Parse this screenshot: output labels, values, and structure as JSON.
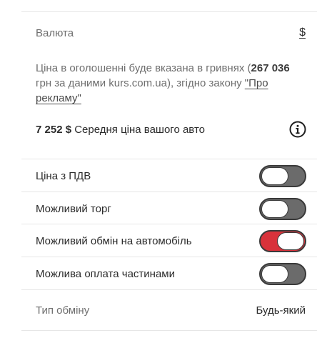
{
  "currency": {
    "label": "Валюта",
    "value": "$"
  },
  "price_note": {
    "text_before": "Ціна в оголошенні буде вказана в гривнях (",
    "amount": "267 036",
    "text_after": " грн за даними kurs.com.ua), згідно закону ",
    "law_link": "\"Про рекламу\""
  },
  "average_price": {
    "amount": "7 252 $",
    "text": " Середня ціна вашого авто",
    "info_icon": "info-circle-icon"
  },
  "options": [
    {
      "label": "Ціна з ПДВ",
      "enabled": false
    },
    {
      "label": "Можливий торг",
      "enabled": false
    },
    {
      "label": "Можливий обмін на автомобіль",
      "enabled": true
    },
    {
      "label": "Можлива оплата частинами",
      "enabled": false
    }
  ],
  "exchange_type": {
    "label": "Тип обміну",
    "value": "Будь-який"
  },
  "colors": {
    "toggle_on": "#d8323b",
    "toggle_off": "#6b6b6b"
  }
}
